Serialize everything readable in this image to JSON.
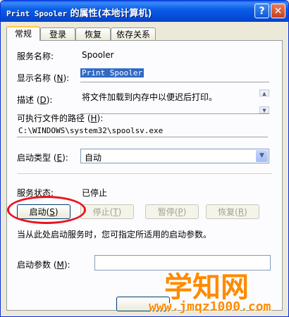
{
  "window": {
    "title_mono": "Print Spooler",
    "title_rest": " 的属性(本地计算机)",
    "help_label": "?",
    "close_label": "✕"
  },
  "tabs": [
    {
      "label": "常规"
    },
    {
      "label": "登录"
    },
    {
      "label": "恢复"
    },
    {
      "label": "依存关系"
    }
  ],
  "general": {
    "service_name_label": "服务名称:",
    "service_name_value": "Spooler",
    "display_name_label_pre": "显示名称 (",
    "display_name_hotkey": "N",
    "display_name_label_post": "):",
    "display_name_value": "Print Spooler",
    "description_label_pre": "描述 (",
    "description_hotkey": "D",
    "description_label_post": "):",
    "description_value": "将文件加载到内存中以便迟后打印。",
    "exe_path_label_pre": "可执行文件的路径 (",
    "exe_path_hotkey": "H",
    "exe_path_label_post": "):",
    "exe_path_value": "C:\\WINDOWS\\system32\\spoolsv.exe",
    "startup_type_label_pre": "启动类型 (",
    "startup_type_hotkey": "E",
    "startup_type_label_post": "):",
    "startup_type_value": "自动",
    "status_label": "服务状态:",
    "status_value": "已停止",
    "buttons": {
      "start_pre": "启动(",
      "start_key": "S",
      "start_post": ")",
      "stop_pre": "停止(",
      "stop_key": "T",
      "stop_post": ")",
      "pause_pre": "暂停(",
      "pause_key": "P",
      "pause_post": ")",
      "resume_pre": "恢复(",
      "resume_key": "R",
      "resume_post": ")"
    },
    "hint_text": "当从此处启动服务时，您可指定所适用的启动参数。",
    "start_params_label_pre": "启动参数 (",
    "start_params_hotkey": "M",
    "start_params_label_post": "):",
    "start_params_value": ""
  },
  "watermark": {
    "main": "学知网",
    "url": "www.jmqz1000.com"
  },
  "colors": {
    "title_bar": "#0a5ee8",
    "highlight_ring": "#e8151d",
    "watermark": "#ff8a00"
  }
}
